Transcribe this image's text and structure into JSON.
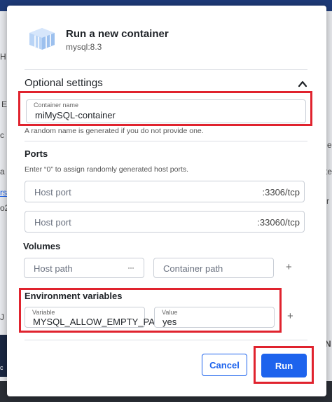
{
  "background": {
    "glyphs": [
      "H",
      "E",
      "c",
      "a",
      "rs",
      "o2",
      "e",
      "te",
      "r",
      "J",
      "N",
      "c"
    ]
  },
  "dialog": {
    "title": "Run a new container",
    "image": "mysql:8.3",
    "icon": "docker-container-icon",
    "optional_settings": {
      "title": "Optional settings",
      "toggle_icon": "chevron-up-icon"
    },
    "container_name": {
      "label": "Container name",
      "value": "miMySQL-container",
      "hint": "A random name is generated if you do not provide one."
    },
    "ports": {
      "title": "Ports",
      "hint": "Enter “0” to assign randomly generated host ports.",
      "rows": [
        {
          "placeholder": "Host port",
          "container_port": ":3306/tcp"
        },
        {
          "placeholder": "Host port",
          "container_port": ":33060/tcp"
        }
      ]
    },
    "volumes": {
      "title": "Volumes",
      "host_placeholder": "Host path",
      "host_browse": "···",
      "container_placeholder": "Container path",
      "add": "+"
    },
    "env": {
      "title": "Environment variables",
      "variable_label": "Variable",
      "variable_value": "MYSQL_ALLOW_EMPTY_PA",
      "value_label": "Value",
      "value_value": "yes",
      "add": "+"
    },
    "actions": {
      "cancel": "Cancel",
      "run": "Run"
    },
    "colors": {
      "accent": "#1d63ed",
      "highlight": "#e0232e"
    }
  }
}
